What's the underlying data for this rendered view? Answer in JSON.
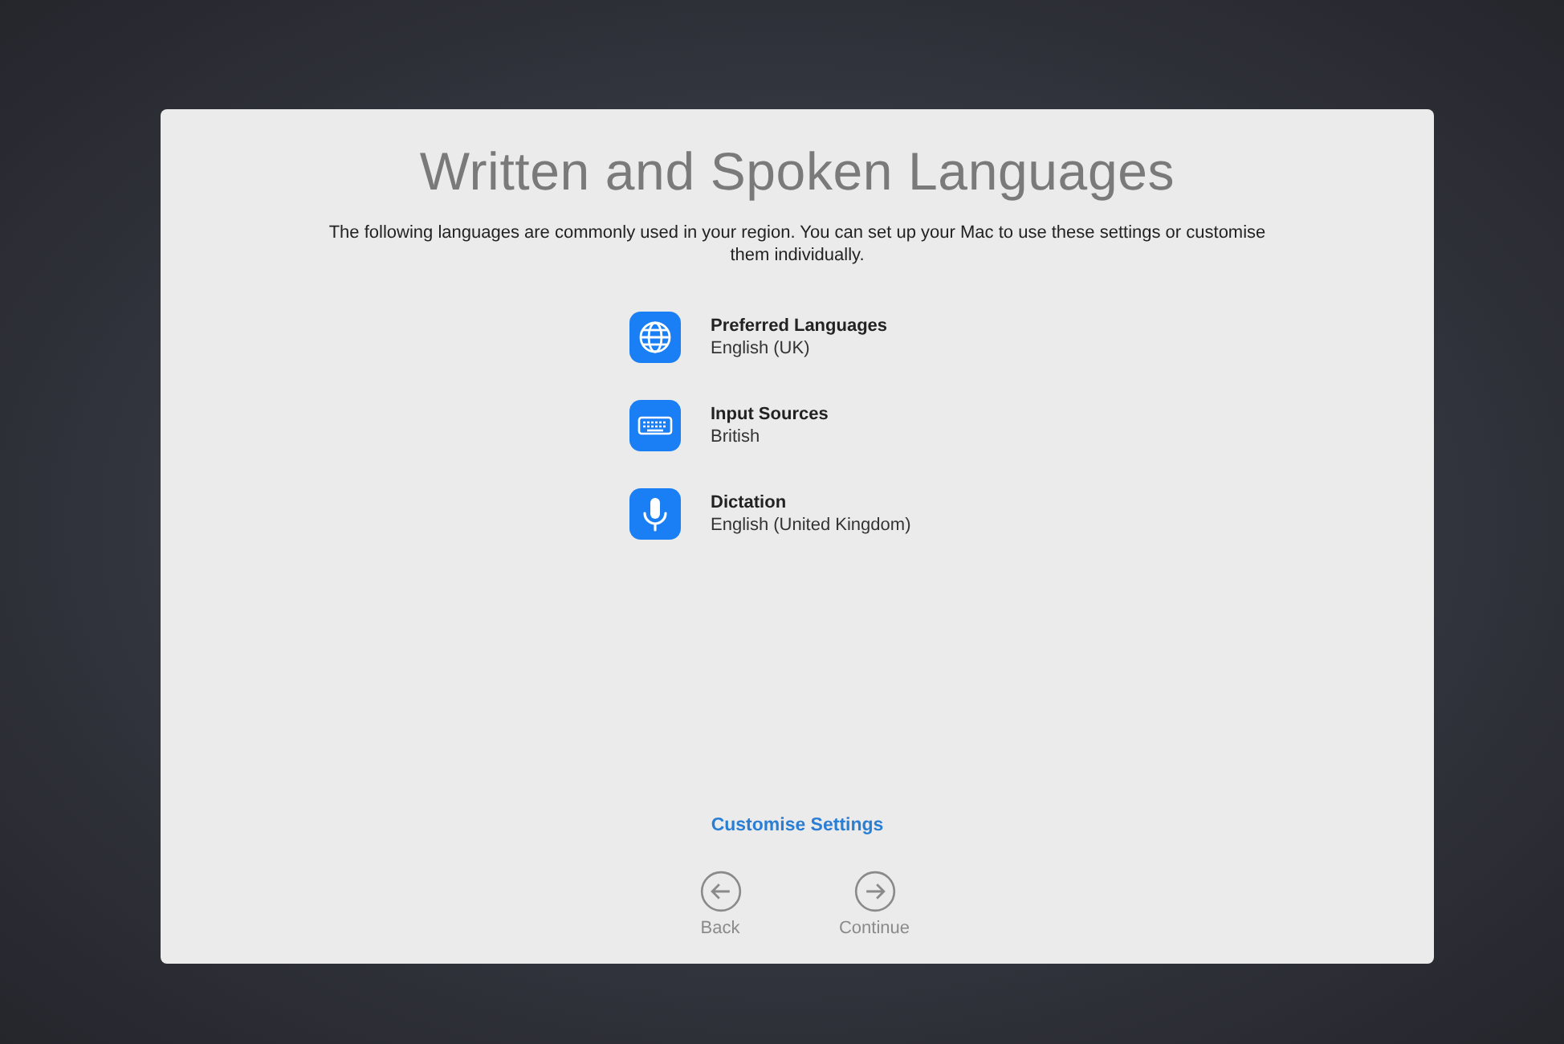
{
  "title": "Written and Spoken Languages",
  "description": "The following languages are commonly used in your region. You can set up your Mac to use these settings or customise them individually.",
  "settings": [
    {
      "kind": "globe",
      "name": "Preferred Languages",
      "value": "English (UK)"
    },
    {
      "kind": "keyboard",
      "name": "Input Sources",
      "value": "British"
    },
    {
      "kind": "microphone",
      "name": "Dictation",
      "value": "English (United Kingdom)"
    }
  ],
  "customise_link": "Customise Settings",
  "nav": [
    {
      "kind": "back",
      "label": "Back"
    },
    {
      "kind": "continue",
      "label": "Continue"
    }
  ]
}
